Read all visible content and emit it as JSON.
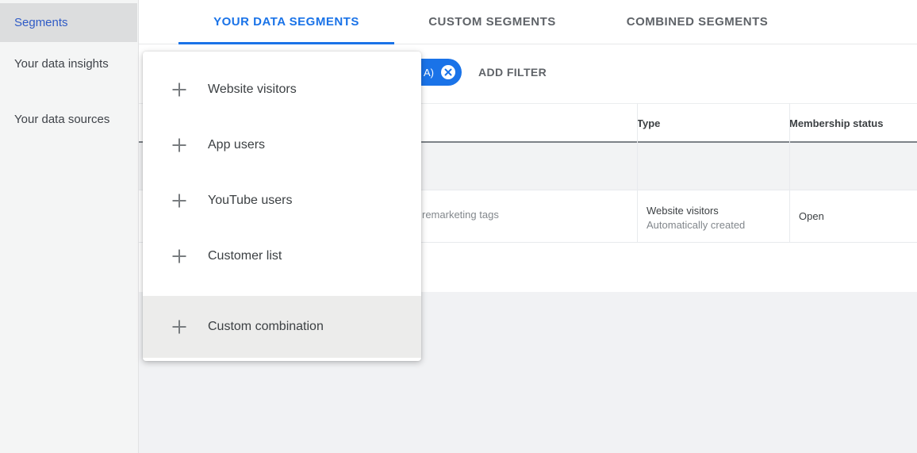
{
  "sidebar": {
    "items": [
      {
        "label": "Segments",
        "selected": true
      },
      {
        "label": "Your data insights",
        "selected": false
      },
      {
        "label": "Your data sources",
        "selected": false
      }
    ]
  },
  "tabs": [
    {
      "label": "YOUR DATA SEGMENTS",
      "active": true
    },
    {
      "label": "CUSTOM SEGMENTS",
      "active": false
    },
    {
      "label": "COMBINED SEGMENTS",
      "active": false
    }
  ],
  "filter_bar": {
    "chip": {
      "text_fragment": "A)",
      "close_icon": "x-in-circle"
    },
    "add_filter_label": "ADD FILTER"
  },
  "table": {
    "columns": [
      {
        "label": "Type"
      },
      {
        "label": "Membership status"
      }
    ],
    "rows": [
      {
        "name_fragment": "remarketing tags",
        "type_primary": "Website visitors",
        "type_secondary": "Automatically created",
        "membership_status": "Open"
      }
    ]
  },
  "menu": {
    "items": [
      {
        "label": "Website visitors",
        "icon": "plus-icon",
        "highlighted": false
      },
      {
        "label": "App users",
        "icon": "plus-icon",
        "highlighted": false
      },
      {
        "label": "YouTube users",
        "icon": "plus-icon",
        "highlighted": false
      },
      {
        "label": "Customer list",
        "icon": "plus-icon",
        "highlighted": false
      },
      {
        "label": "Custom combination",
        "icon": "plus-icon",
        "highlighted": true
      }
    ]
  },
  "colors": {
    "accent_blue": "#1a73e8",
    "sidebar_selected_text": "#2f5bc6",
    "text_dark": "#3c4043",
    "text_gray": "#82878c",
    "band_gray": "#f2f3f4",
    "hover_gray": "#ececeb"
  }
}
